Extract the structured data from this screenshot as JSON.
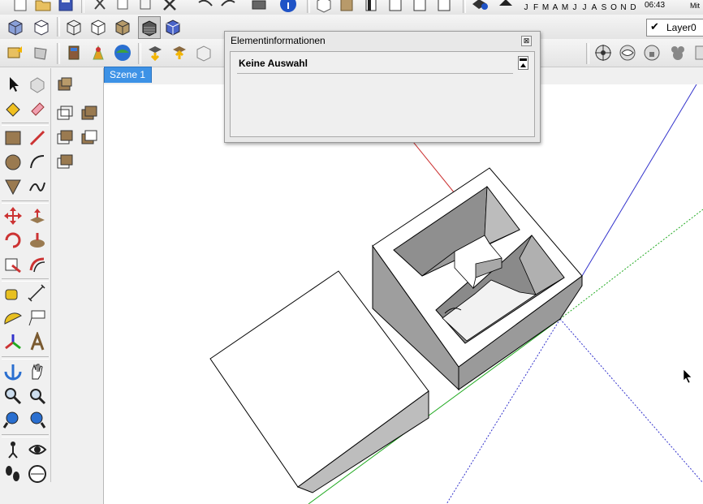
{
  "toolbar": {
    "months": [
      "J",
      "F",
      "M",
      "A",
      "M",
      "J",
      "J",
      "A",
      "S",
      "O",
      "N",
      "D"
    ],
    "time": "06:43",
    "cut_label": "Mit",
    "layer": "Layer0"
  },
  "scene_tab": {
    "label": "Szene 1"
  },
  "entity_info": {
    "title": "Elementinformationen",
    "close_glyph": "⊠",
    "selection_text": "Keine Auswahl"
  },
  "icons": {
    "top_row": [
      "new-icon",
      "open-icon",
      "save-icon",
      "cut-icon",
      "copy-icon",
      "paste-icon",
      "erase-icon",
      "print-icon",
      "info-icon",
      "box-icon",
      "door-icon",
      "window-icon",
      "camera-icon",
      "info-circle-icon",
      "shadow-icon"
    ],
    "views_row": [
      "iso-icon",
      "top-view-icon",
      "front-view-icon",
      "right-view-icon",
      "back-view-icon",
      "left-view-icon"
    ],
    "styles_row": [
      "xray-icon",
      "wireframe-icon",
      "hidden-line-icon",
      "shaded-icon",
      "textured-icon",
      "monochrome-icon"
    ],
    "warehouse_row": [
      "get-models-icon",
      "share-model-icon",
      "component-icon",
      "extension-icon",
      "google-earth-icon",
      "get-photo-icon",
      "place-model-icon",
      "toggle-terrain-icon"
    ],
    "right_row": [
      "position-camera-icon",
      "look-around-icon",
      "walk-icon",
      "animal-icon",
      "section-icon"
    ],
    "accent_colors": {
      "scene_tab": "#3d92e6",
      "red_axis": "#cc3333",
      "green_axis": "#22aa22",
      "blue_axis": "#3333cc",
      "face_gray": "#9a9a9a",
      "face_light": "#bdbdbd"
    }
  }
}
